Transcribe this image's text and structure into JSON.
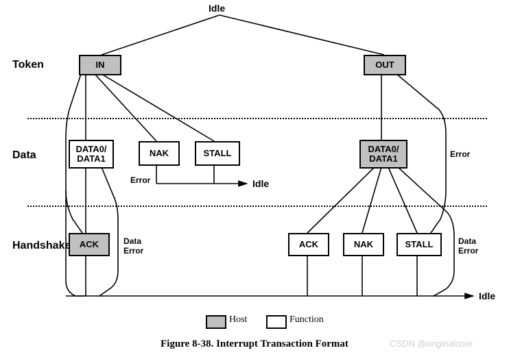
{
  "labels": {
    "idle_top": "Idle",
    "row_token": "Token",
    "row_data": "Data",
    "row_handshake": "Handshake",
    "idle_mid": "Idle",
    "idle_bottom": "Idle",
    "error_left": "Error",
    "error_right": "Error",
    "data_error_left": "Data\nError",
    "data_error_right": "Data\nError"
  },
  "boxes": {
    "in": "IN",
    "out": "OUT",
    "data_left": "DATA0/\nDATA1",
    "nak_mid": "NAK",
    "stall_mid": "STALL",
    "data_right": "DATA0/\nDATA1",
    "ack_left": "ACK",
    "ack_r": "ACK",
    "nak_r": "NAK",
    "stall_r": "STALL"
  },
  "legend": {
    "host": "Host",
    "function": "Function"
  },
  "caption": "Figure 8-38.  Interrupt Transaction Format",
  "watermark": "CSDN @originalcore"
}
